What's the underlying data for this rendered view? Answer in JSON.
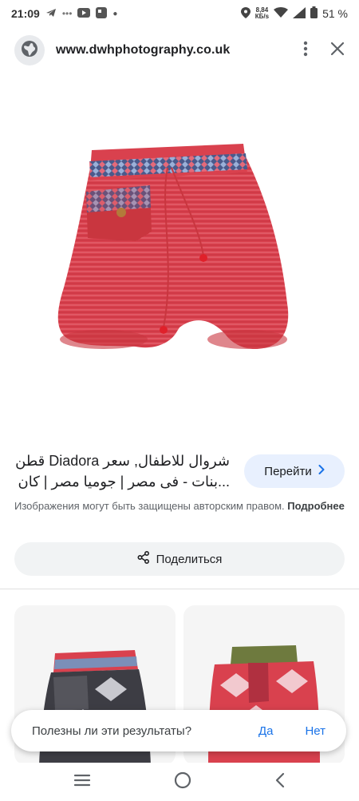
{
  "status_bar": {
    "time": "21:09",
    "speed_value": "8,84",
    "speed_unit": "КБ/s",
    "battery": "51 %"
  },
  "address_bar": {
    "url": "www.dwhphotography.co.uk"
  },
  "result": {
    "title_line1": "شروال للاطفال, سعر Diadora قطن",
    "title_line2": "...بنات - فى مصر | جوميا مصر | كان",
    "go_label": "Перейти",
    "copyright_text": "Изображения могут быть защищены авторским правом.",
    "more_link": "Подробнее",
    "share_label": "Поделиться"
  },
  "feedback": {
    "question": "Полезны ли эти результаты?",
    "yes": "Да",
    "no": "Нет"
  },
  "colors": {
    "accent": "#1a73e8",
    "go_bg": "#e8f0fe",
    "pants_red": "#d9414e"
  }
}
